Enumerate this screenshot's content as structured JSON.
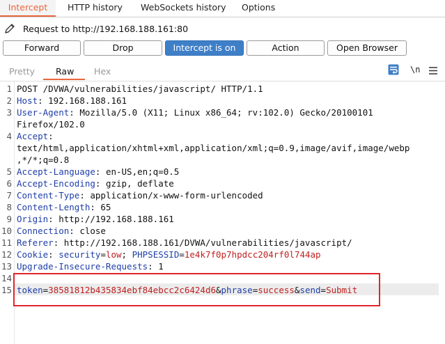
{
  "tabs": [
    "Intercept",
    "HTTP history",
    "WebSockets history",
    "Options"
  ],
  "request_line": "Request to http://192.168.188.161:80",
  "buttons": {
    "forward": "Forward",
    "drop": "Drop",
    "intercept": "Intercept is on",
    "action": "Action",
    "open_browser": "Open Browser"
  },
  "view_tabs": [
    "Pretty",
    "Raw",
    "Hex"
  ],
  "toolbar": {
    "newline_toggle": "\\n"
  },
  "line_numbers": [
    "1",
    "2",
    "3",
    "",
    "4",
    "",
    "",
    "5",
    "6",
    "7",
    "8",
    "9",
    "10",
    "11",
    "12",
    "13",
    "14",
    "15"
  ],
  "lines": {
    "l1": "POST /DVWA/vulnerabilities/javascript/ HTTP/1.1",
    "l2k": "Host",
    "l2v": ": 192.168.188.161",
    "l3k": "User-Agent",
    "l3v": ": Mozilla/5.0 (X11; Linux x86_64; rv:102.0) Gecko/20100101",
    "l3c": "Firefox/102.0",
    "l4k": "Accept",
    "l4v": ":",
    "l4c1": "text/html,application/xhtml+xml,application/xml;q=0.9,image/avif,image/webp",
    "l4c2": ",*/*;q=0.8",
    "l5k": "Accept-Language",
    "l5v": ": en-US,en;q=0.5",
    "l6k": "Accept-Encoding",
    "l6v": ": gzip, deflate",
    "l7k": "Content-Type",
    "l7v": ": application/x-www-form-urlencoded",
    "l8k": "Content-Length",
    "l8v": ": 65",
    "l9k": "Origin",
    "l9v": ": http://192.168.188.161",
    "l10k": "Connection",
    "l10v": ": close",
    "l11k": "Referer",
    "l11v": ": http://192.168.188.161/DVWA/vulnerabilities/javascript/",
    "l12k": "Cookie",
    "l12s": ": ",
    "l12c1k": "security",
    "l12c1e": "=",
    "l12c1v": "low",
    "l12sep": "; ",
    "l12c2k": "PHPSESSID",
    "l12c2e": "=",
    "l12c2v": "1e4k7f0p7hpdcc204rf0l744ap",
    "l13k": "Upgrade-Insecure-Requests",
    "l13v": ": 1",
    "body": {
      "p1k": "token",
      "p1e": "=",
      "p1v": "38581812b435834ebf84ebcc2c6424d6",
      "a1": "&",
      "p2k": "phrase",
      "p2e": "=",
      "p2v": "success",
      "a2": "&",
      "p3k": "send",
      "p3e": "=",
      "p3v": "Submit"
    }
  },
  "colors": {
    "accent": "#e8663c",
    "button_on": "#3f7fc8",
    "header_key": "#1f3ea8",
    "param_value": "#c02020",
    "highlight_box": "#e3242b"
  }
}
